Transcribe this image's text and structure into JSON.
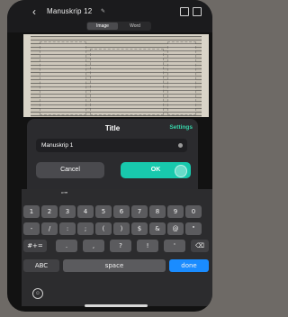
{
  "header": {
    "back_icon": "chevron-left-icon",
    "doc_title": "Manuskrip 12",
    "tabs": [
      {
        "label": "Image",
        "active": true
      },
      {
        "label": "Word",
        "active": false
      }
    ],
    "right_icons": [
      "grid-icon",
      "share-icon"
    ]
  },
  "dialog": {
    "title": "Title",
    "settings_label": "Settings",
    "title_value": "Manuskrip 1",
    "cancel_label": "Cancel",
    "ok_label": "OK",
    "accent_color": "#18c9ad"
  },
  "keyboard": {
    "prediction": "“\"”",
    "row1": [
      "1",
      "2",
      "3",
      "4",
      "5",
      "6",
      "7",
      "8",
      "9",
      "0"
    ],
    "row2": [
      "-",
      "/",
      ":",
      ";",
      "(",
      ")",
      "$",
      "&",
      "@",
      "\""
    ],
    "row3": [
      "#+=",
      ".",
      ",",
      "?",
      "!",
      "'",
      "⌫"
    ],
    "row4": [
      "ABC",
      "space",
      "done"
    ],
    "emoji_icon": "emoji-icon"
  }
}
